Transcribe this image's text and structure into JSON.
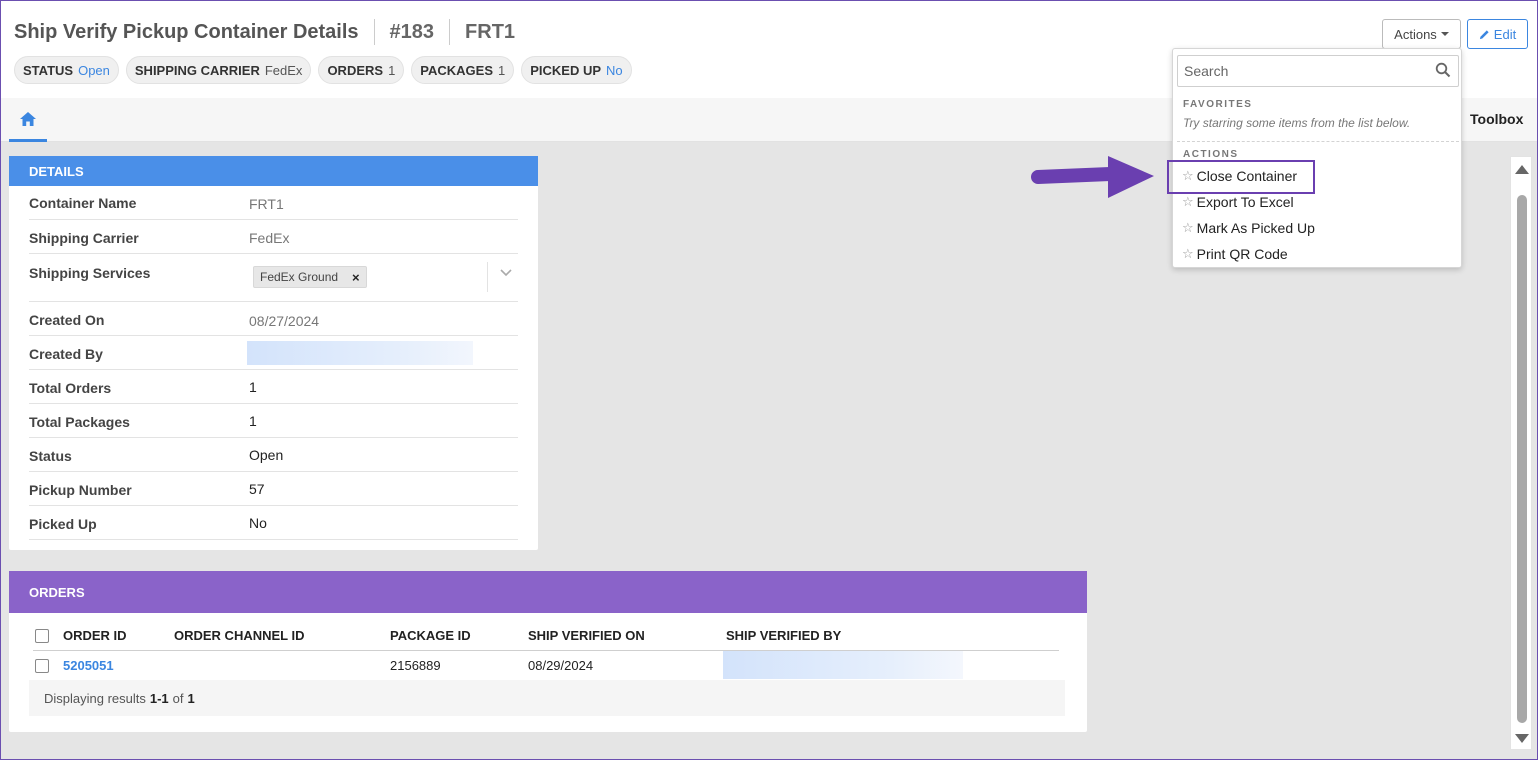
{
  "header": {
    "title": "Ship Verify Pickup Container Details",
    "id": "#183",
    "name": "FRT1",
    "actions_label": "Actions",
    "edit_label": "Edit"
  },
  "pills": [
    {
      "key": "STATUS",
      "value": "Open",
      "color": "#3b86e0"
    },
    {
      "key": "SHIPPING CARRIER",
      "value": "FedEx"
    },
    {
      "key": "ORDERS",
      "value": "1"
    },
    {
      "key": "PACKAGES",
      "value": "1"
    },
    {
      "key": "PICKED UP",
      "value": "No",
      "color": "#3b86e0"
    }
  ],
  "tabs": {
    "home_icon": "home-icon",
    "toolbox": "Toolbox"
  },
  "details": {
    "heading": "DETAILS",
    "rows": [
      {
        "label": "Container Name",
        "value": "FRT1"
      },
      {
        "label": "Shipping Carrier",
        "value": "FedEx"
      },
      {
        "label": "Shipping Services",
        "value": "FedEx Ground"
      },
      {
        "label": "Created On",
        "value": "08/27/2024"
      },
      {
        "label": "Created By",
        "value": ""
      },
      {
        "label": "Total Orders",
        "value": "1"
      },
      {
        "label": "Total Packages",
        "value": "1"
      },
      {
        "label": "Status",
        "value": "Open"
      },
      {
        "label": "Pickup Number",
        "value": "57"
      },
      {
        "label": "Picked Up",
        "value": "No"
      }
    ],
    "chip_remove": "×"
  },
  "orders": {
    "heading": "ORDERS",
    "columns": [
      "ORDER ID",
      "ORDER CHANNEL ID",
      "PACKAGE ID",
      "SHIP VERIFIED ON",
      "SHIP VERIFIED BY"
    ],
    "rows": [
      {
        "order_id": "5205051",
        "channel_id": "",
        "package_id": "2156889",
        "verified_on": "08/29/2024",
        "verified_by": ""
      }
    ],
    "footer": {
      "prefix": "Displaying results",
      "range": "1-1",
      "of": "of",
      "total": "1"
    }
  },
  "dropdown": {
    "search_placeholder": "Search",
    "favorites_label": "FAVORITES",
    "favorites_hint": "Try starring some items from the list below.",
    "actions_label": "ACTIONS",
    "items": [
      "Close Container",
      "Export To Excel",
      "Mark As Picked Up",
      "Print QR Code"
    ]
  },
  "colors": {
    "details_header": "#4a8fe8",
    "orders_header": "#8a63c9",
    "link": "#3b86e0",
    "annotation": "#6a3fb0"
  }
}
